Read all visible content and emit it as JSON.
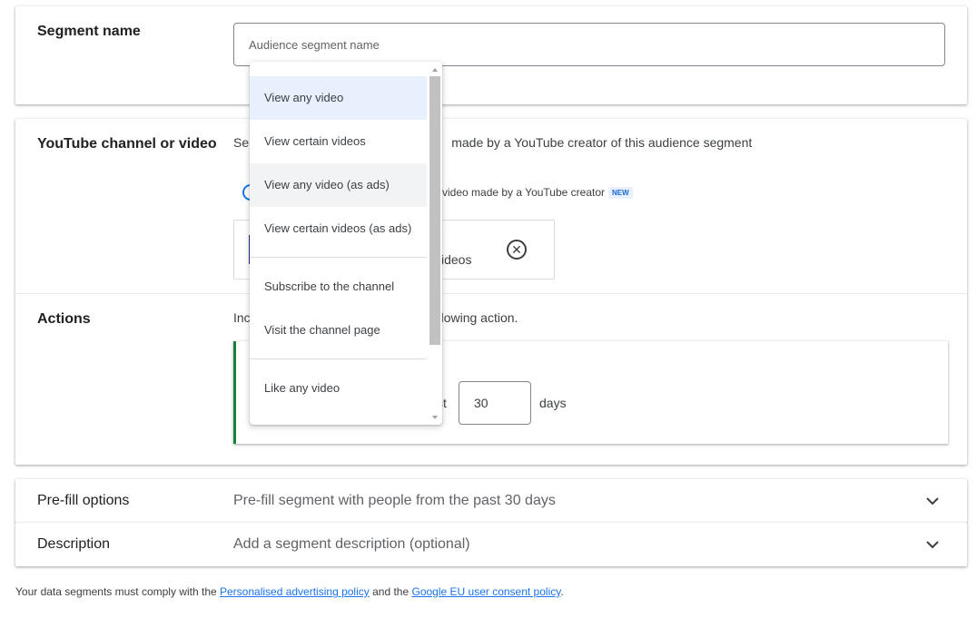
{
  "segment_name": {
    "title": "Segment name",
    "placeholder": "Audience segment name"
  },
  "channel_video": {
    "title": "YouTube channel or video",
    "description_prefix": "Sel",
    "description_suffix": "made by a YouTube creator of this audience segment",
    "radio_label": "video made by a YouTube creator",
    "new_badge": "NEW",
    "chip_text": "ideos"
  },
  "actions": {
    "title": "Actions",
    "description_prefix": "Inc",
    "description_suffix": "ollowing action.",
    "days_prefix": "st",
    "days_value": "30",
    "days_label": "days"
  },
  "prefill": {
    "title": "Pre-fill options",
    "value": "Pre-fill segment with people from the past 30 days"
  },
  "description": {
    "title": "Description",
    "value": "Add a segment description (optional)"
  },
  "footer": {
    "prefix": "Your data segments must comply with the ",
    "link1": "Personalised advertising policy",
    "middle": " and the ",
    "link2": "Google EU user consent policy",
    "suffix": "."
  },
  "menu": {
    "items": [
      "View any video",
      "View certain videos",
      "View any video (as ads)",
      "View certain videos (as ads)",
      "Subscribe to the channel",
      "Visit the channel page",
      "Like any video"
    ]
  },
  "colors": {
    "accent": "#1a73e8",
    "selected_bg": "#e8f0fe",
    "success_border": "#188038"
  }
}
